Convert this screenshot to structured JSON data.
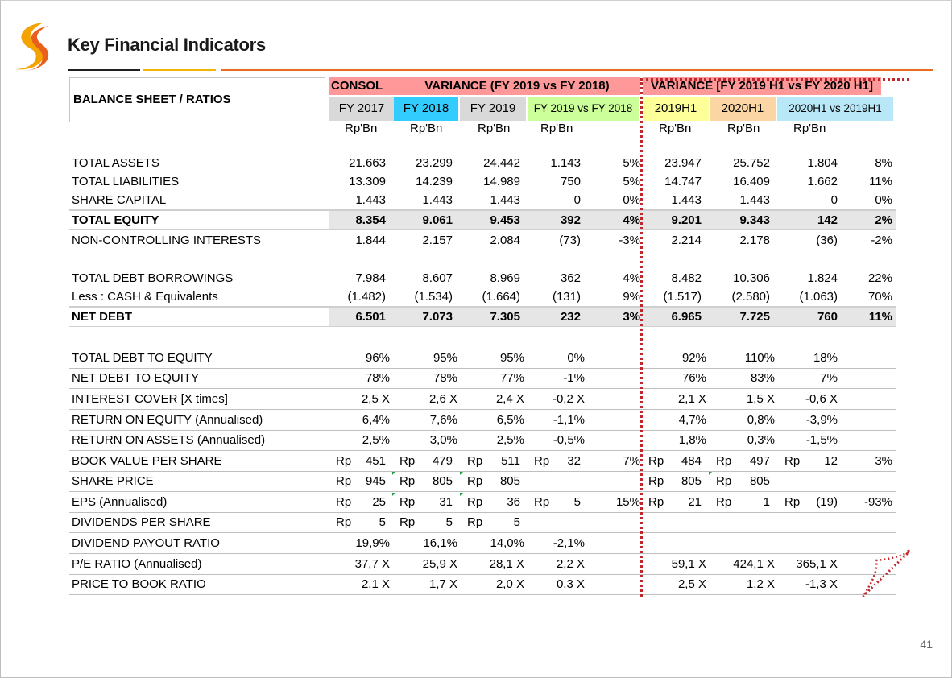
{
  "title": "Key Financial Indicators",
  "page_number": "41",
  "header": {
    "section_label": "BALANCE SHEET / RATIOS",
    "group1": "CONSOL @",
    "group2": "VARIANCE (FY 2019 vs FY 2018)",
    "group3": "VARIANCE [FY 2019 H1 vs FY 2020 H1]",
    "cols": [
      "FY 2017",
      "FY 2018",
      "FY 2019",
      "FY 2019 vs FY 2018",
      "2019H1",
      "2020H1",
      "2020H1 vs 2019H1"
    ],
    "units": [
      "Rp'Bn",
      "Rp'Bn",
      "Rp'Bn",
      "Rp'Bn",
      "Rp'Bn",
      "Rp'Bn",
      "Rp'Bn"
    ],
    "colors": {
      "group1": "#ff9999",
      "group2": "#ff9999",
      "group3": "#ff9999",
      "fy2017": "#d9d9d9",
      "fy2018": "#33ccff",
      "fy2019": "#d9d9d9",
      "var1": "#ccff99",
      "h1_2019": "#ffff99",
      "h1_2020": "#fcd5a4",
      "var2": "#b8e8f8"
    }
  },
  "rows": [
    {
      "label": "TOTAL ASSETS",
      "v": [
        "21.663",
        "23.299",
        "24.442",
        "1.143",
        "5%",
        "23.947",
        "25.752",
        "1.804",
        "8%"
      ]
    },
    {
      "label": "TOTAL LIABILITIES",
      "v": [
        "13.309",
        "14.239",
        "14.989",
        "750",
        "5%",
        "14.747",
        "16.409",
        "1.662",
        "11%"
      ]
    },
    {
      "label": "SHARE CAPITAL",
      "v": [
        "1.443",
        "1.443",
        "1.443",
        "0",
        "0%",
        "1.443",
        "1.443",
        "0",
        "0%"
      ]
    },
    {
      "label": "TOTAL EQUITY",
      "v": [
        "8.354",
        "9.061",
        "9.453",
        "392",
        "4%",
        "9.201",
        "9.343",
        "142",
        "2%"
      ]
    },
    {
      "label": "NON-CONTROLLING INTERESTS",
      "v": [
        "1.844",
        "2.157",
        "2.084",
        "(73)",
        "-3%",
        "2.214",
        "2.178",
        "(36)",
        "-2%"
      ]
    },
    {
      "label": "TOTAL DEBT BORROWINGS",
      "v": [
        "7.984",
        "8.607",
        "8.969",
        "362",
        "4%",
        "8.482",
        "10.306",
        "1.824",
        "22%"
      ]
    },
    {
      "label": "Less : CASH & Equivalents",
      "v": [
        "(1.482)",
        "(1.534)",
        "(1.664)",
        "(131)",
        "9%",
        "(1.517)",
        "(2.580)",
        "(1.063)",
        "70%"
      ]
    },
    {
      "label": "NET DEBT",
      "v": [
        "6.501",
        "7.073",
        "7.305",
        "232",
        "3%",
        "6.965",
        "7.725",
        "760",
        "11%"
      ]
    }
  ],
  "ratios": [
    {
      "label": "TOTAL DEBT TO EQUITY",
      "v": [
        "96%",
        "95%",
        "95%",
        "0%",
        "92%",
        "110%",
        "18%"
      ]
    },
    {
      "label": "NET DEBT TO EQUITY",
      "v": [
        "78%",
        "78%",
        "77%",
        "-1%",
        "76%",
        "83%",
        "7%"
      ]
    },
    {
      "label": "INTEREST COVER [X times]",
      "v": [
        "2,5 X",
        "2,6 X",
        "2,4 X",
        "-0,2 X",
        "2,1 X",
        "1,5 X",
        "-0,6 X"
      ]
    },
    {
      "label": "RETURN ON EQUITY (Annualised)",
      "v": [
        "6,4%",
        "7,6%",
        "6,5%",
        "-1,1%",
        "4,7%",
        "0,8%",
        "-3,9%"
      ]
    },
    {
      "label": "RETURN ON ASSETS (Annualised)",
      "v": [
        "2,5%",
        "3,0%",
        "2,5%",
        "-0,5%",
        "1,8%",
        "0,3%",
        "-1,5%"
      ]
    }
  ],
  "per_share": [
    {
      "label": "BOOK VALUE PER SHARE",
      "v": [
        "451",
        "479",
        "511",
        "32",
        "7%",
        "484",
        "497",
        "12",
        "3%"
      ]
    },
    {
      "label": "SHARE PRICE",
      "v": [
        "945",
        "805",
        "805",
        "",
        "",
        "805",
        "805",
        "",
        ""
      ]
    },
    {
      "label": "EPS (Annualised)",
      "v": [
        "25",
        "31",
        "36",
        "5",
        "15%",
        "21",
        "1",
        "(19)",
        "-93%"
      ]
    },
    {
      "label": "DIVIDENDS PER SHARE",
      "v": [
        "5",
        "5",
        "5",
        "",
        "",
        "",
        "",
        "",
        ""
      ]
    }
  ],
  "per_share_currency": "Rp",
  "tail": [
    {
      "label": "DIVIDEND PAYOUT RATIO",
      "v": [
        "19,9%",
        "16,1%",
        "14,0%",
        "-2,1%",
        "",
        "",
        ""
      ]
    },
    {
      "label": "P/E RATIO (Annualised)",
      "v": [
        "37,7 X",
        "25,9 X",
        "28,1 X",
        "2,2 X",
        "59,1 X",
        "424,1 X",
        "365,1 X"
      ]
    },
    {
      "label": "PRICE TO BOOK RATIO",
      "v": [
        "2,1 X",
        "1,7 X",
        "2,0 X",
        "0,3 X",
        "2,5 X",
        "1,2 X",
        "-1,3 X"
      ]
    }
  ]
}
